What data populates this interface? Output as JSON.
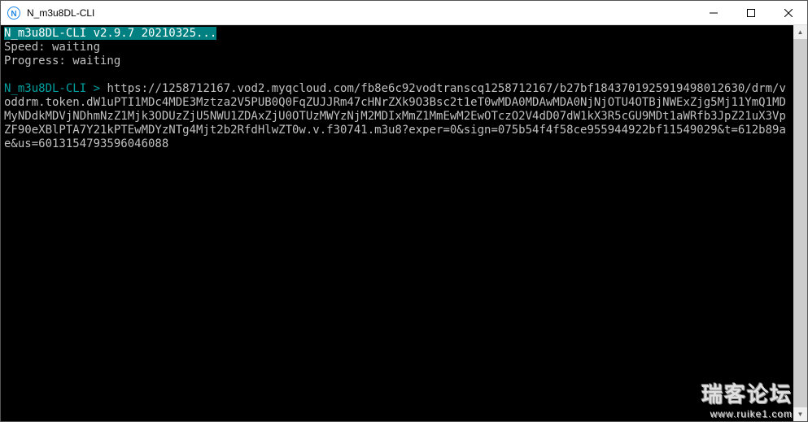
{
  "titlebar": {
    "icon_letter": "N",
    "icon_bg": "#1E88E5",
    "title": "N_m3u8DL-CLI"
  },
  "terminal": {
    "header_highlight": "N_m3u8DL-CLI v2.9.7 20210325...",
    "speed_line": "Speed: waiting",
    "progress_line": "Progress: waiting",
    "prompt": "N_m3u8DL-CLI > ",
    "command": "https://1258712167.vod2.myqcloud.com/fb8e6c92vodtranscq1258712167/b27bf1843701925919498012630/drm/voddrm.token.dW1uPTI1MDc4MDE3Mztza2V5PUB0Q0FqZUJJRm47cHNrZXk9O3Bsc2t1eT0wMDA0MDAwMDA0NjNjOTU4OTBjNWExZjg5Mj11YmQ1MDMyNDdkMDVjNDhmNzZ1Mjk3ODUzZjU5NWU1ZDAxZjU0OTUzMWYzNjM2MDIxMmZ1MmEwM2EwOTczO2V4dD07dW1kX3R5cGU9MDt1aWRfb3JpZ21uX3VpZF90eXBlPTA7Y21kPTEwMDYzNTg4Mjt2b2RfdHlwZT0w.v.f30741.m3u8?exper=0&sign=075b54f4f58ce955944922bf11549029&t=612b89ae&us=6013154793596046088"
  },
  "watermark": {
    "big": "瑞客论坛",
    "small": "www.ruike1.com"
  },
  "scrollbar": {
    "up": "▲",
    "down": "▼"
  }
}
